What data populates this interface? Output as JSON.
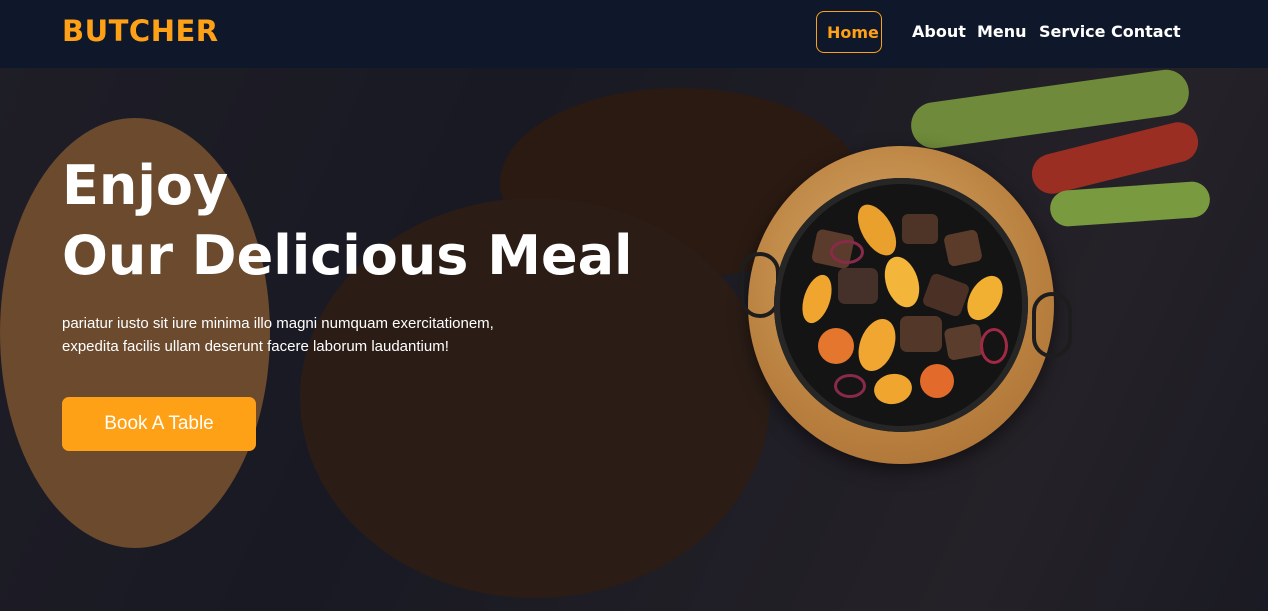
{
  "brand": {
    "name": "BUTCHER"
  },
  "nav": {
    "items": [
      {
        "label": "Home",
        "active": true
      },
      {
        "label": "About",
        "active": false
      },
      {
        "label": "Menu",
        "active": false
      },
      {
        "label": "Service",
        "active": false
      },
      {
        "label": "Contact",
        "active": false
      }
    ]
  },
  "hero": {
    "title_line1": "Enjoy",
    "title_line2": "Our Delicious Meal",
    "subtitle": "pariatur iusto sit iure minima illo magni numquam exercitationem, expedita facilis ullam deserunt facere laborum laudantium!",
    "cta_label": "Book A Table",
    "image_icon": "dish-image"
  },
  "colors": {
    "accent": "#fea116",
    "nav_bg": "#0f172b",
    "text": "#ffffff"
  }
}
